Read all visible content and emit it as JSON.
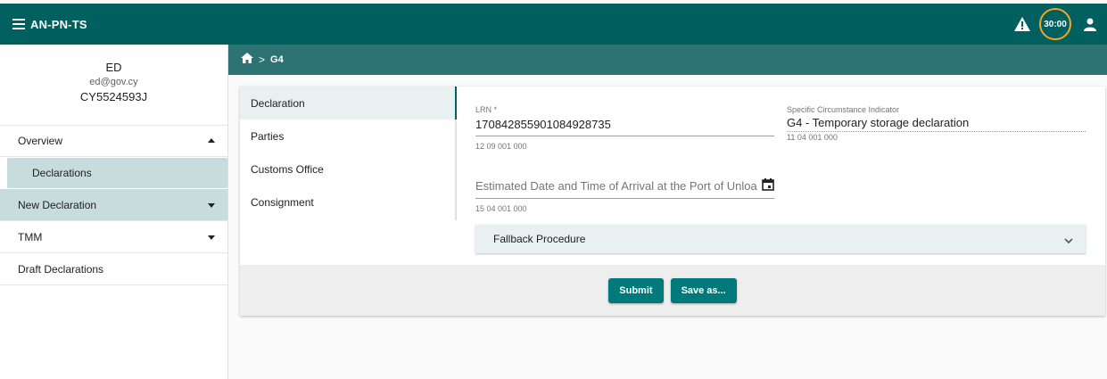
{
  "header": {
    "app_title": "AN-PN-TS",
    "timer": "30:00",
    "icons": [
      "menu-icon",
      "warning-icon",
      "user-icon"
    ]
  },
  "profile": {
    "name": "ED",
    "email": "ed@gov.cy",
    "eori": "CY5524593J"
  },
  "sidebar": {
    "items": [
      {
        "label": "Overview"
      },
      {
        "label": "Declarations"
      },
      {
        "label": "New Declaration"
      },
      {
        "label": "TMM"
      },
      {
        "label": "Draft Declarations"
      }
    ]
  },
  "breadcrumb": {
    "home_icon": "home-icon",
    "current": "G4"
  },
  "steps": [
    {
      "label": "Declaration"
    },
    {
      "label": "Parties"
    },
    {
      "label": "Customs Office"
    },
    {
      "label": "Consignment"
    }
  ],
  "form": {
    "lrn": {
      "label": "LRN *",
      "value": "17084285590108492873​5",
      "code": "12 09 001 000"
    },
    "sci": {
      "label": "Specific Circumstance Indicator",
      "value": "G4 - Temporary storage declaration",
      "code": "11 04 001 000"
    },
    "eta": {
      "placeholder": "Estimated Date and Time of Arrival at the Port of Unloading",
      "code": "15 04 001 000"
    },
    "fallback": {
      "label": "Fallback Procedure"
    }
  },
  "actions": {
    "submit": "Submit",
    "save_as": "Save as..."
  },
  "colors": {
    "primary": "#005f5f",
    "breadcrumb_bg": "#2d7373",
    "button": "#00797a",
    "timer_ring": "#f5a623",
    "selected_bg": "#c7dcdc"
  }
}
